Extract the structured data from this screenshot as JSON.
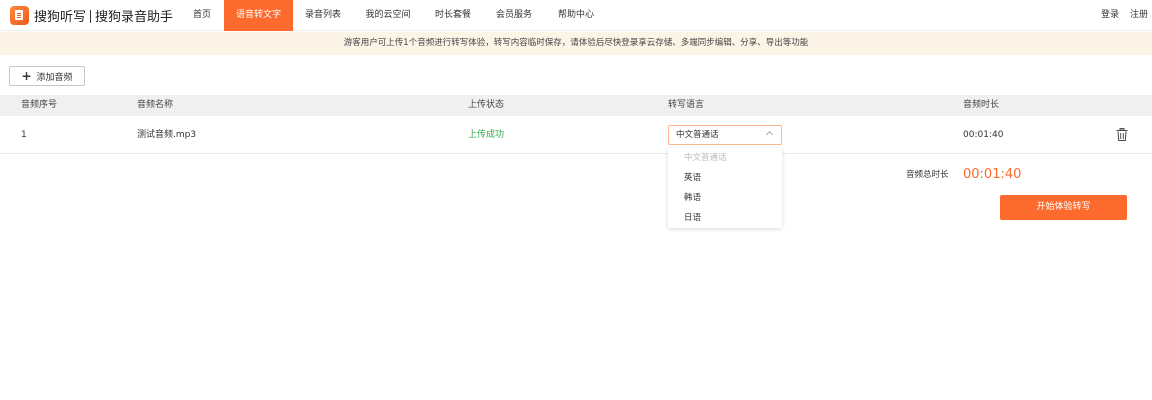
{
  "header": {
    "logo_primary": "搜狗听写",
    "logo_secondary": "搜狗录音助手",
    "nav": [
      {
        "label": "首页",
        "active": false
      },
      {
        "label": "语音转文字",
        "active": true
      },
      {
        "label": "录音列表",
        "active": false
      },
      {
        "label": "我的云空间",
        "active": false
      },
      {
        "label": "时长套餐",
        "active": false
      },
      {
        "label": "会员服务",
        "active": false
      },
      {
        "label": "帮助中心",
        "active": false
      }
    ],
    "login": "登录",
    "register": "注册"
  },
  "notice": "游客用户可上传1个音频进行转写体验，转写内容临时保存，请体验后尽快登录享云存储、多端同步编辑、分享、导出等功能",
  "toolbar": {
    "add_audio": "添加音频"
  },
  "table": {
    "columns": [
      "音频序号",
      "音频名称",
      "上传状态",
      "转写语言",
      "音频时长"
    ],
    "rows": [
      {
        "index": "1",
        "name": "测试音频.mp3",
        "status": "上传成功",
        "language": "中文普通话",
        "duration": "00:01:40"
      }
    ]
  },
  "language_dropdown": {
    "options": [
      {
        "label": "中文普通话",
        "disabled": true
      },
      {
        "label": "英语",
        "disabled": false
      },
      {
        "label": "韩语",
        "disabled": false
      },
      {
        "label": "日语",
        "disabled": false
      }
    ]
  },
  "summary": {
    "total_label": "音频总时长",
    "total_value": "00:01:40"
  },
  "start_button": "开始体验转写",
  "colors": {
    "accent": "#fd6a2d",
    "success": "#2fa84a",
    "notice_bg": "#fdf4e8"
  }
}
